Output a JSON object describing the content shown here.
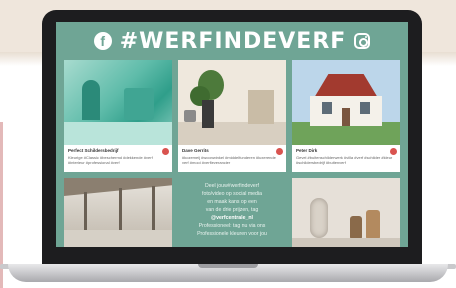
{
  "header": {
    "facebook_glyph": "f",
    "hashtag": "#WERFINDEVERF",
    "icons": [
      "facebook-icon",
      "instagram-icon"
    ]
  },
  "cards": [
    {
      "name": "Perfect Schildersbedrijf",
      "caption": "Kleurige #Classic #beschermd #dekkende #verf #interieur #professional #verf"
    },
    {
      "name": "Dave Gerrits",
      "caption": "#kozemeij #woonwinkel #middelfunderen #luxerende verf #mooi #verfleverancier"
    },
    {
      "name": "Peter Dirk",
      "caption": "Gevel #buitenschilderwerk #villa #verf #schilder #kleur #schildersbedrijf #buitenverf"
    }
  ],
  "promo": {
    "line1": "Deel jouw#werfindeverf",
    "line2": "foto/video op social media",
    "line3": "en maak kans op een",
    "line4": "van de drie prijzen, tag",
    "line5": "@verfcentrale_nl",
    "line6": "Professioneel: tag nu via ons",
    "line7": "Professionele kleuren voor jou"
  },
  "colors": {
    "screen_bg": "#6fa595",
    "bezel": "#1d1d1f"
  }
}
